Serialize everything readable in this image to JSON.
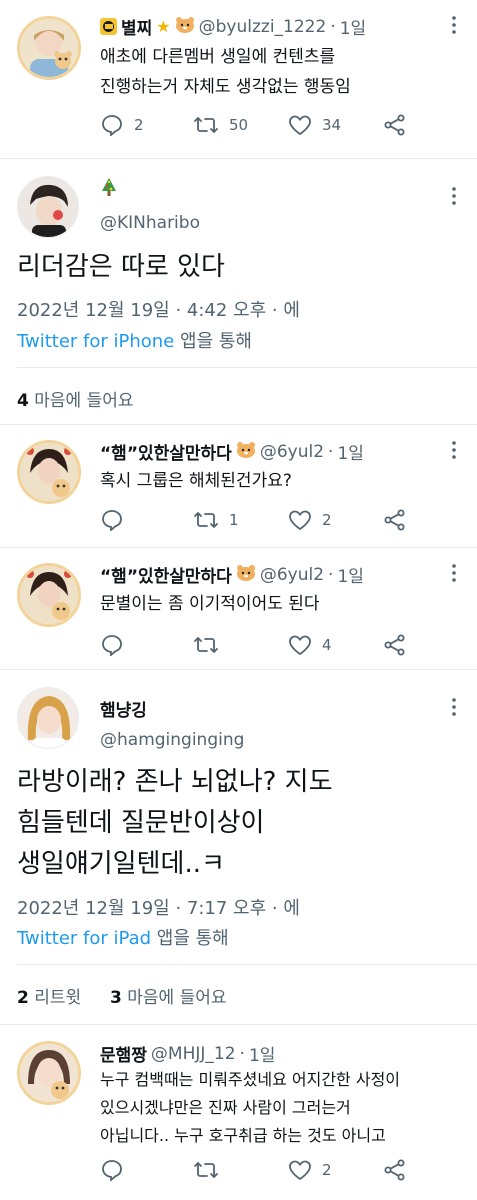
{
  "tweets": [
    {
      "name": "별찌",
      "name_emojis": "🌟🐹",
      "handle": "@byulzzi_1222",
      "time": "1일",
      "text_lines": [
        "애초에 다른멤버 생일에 컨텐츠를",
        "진행하는거 자체도 생각없는 행동임"
      ],
      "replies": "2",
      "retweets": "50",
      "likes": "34"
    },
    {
      "name_emoji": "🎄",
      "handle": "@KINharibo",
      "text": "리더감은 따로 있다",
      "date": "2022년 12월 19일 · 4:42 오후 · 에",
      "source_link": "Twitter for iPhone",
      "source_suffix": " 앱을 통해",
      "likes_count": "4",
      "likes_label": "마음에 들어요"
    },
    {
      "name": "“햄”있한살만하다",
      "name_emoji": "🐹",
      "handle": "@6yul2",
      "time": "1일",
      "text": "혹시 그룹은 해체된건가요?",
      "replies": "",
      "retweets": "1",
      "likes": "2"
    },
    {
      "name": "“햄”있한살만하다",
      "name_emoji": "🐹",
      "handle": "@6yul2",
      "time": "1일",
      "text": "문별이는 좀 이기적이어도 된다",
      "replies": "",
      "retweets": "",
      "likes": "4"
    },
    {
      "name": "햄냥깅",
      "handle": "@hamginginging",
      "text_lines": [
        "라방이래? 존나 뇌없나? 지도",
        "힘들텐데 질문반이상이",
        "생일얘기일텐데..ㅋ"
      ],
      "date": "2022년 12월 19일 · 7:17 오후 · 에",
      "source_link": "Twitter for iPad",
      "source_suffix": " 앱을 통해",
      "retweets_count": "2",
      "retweets_label": "리트윗",
      "likes_count": "3",
      "likes_label": "마음에 들어요"
    },
    {
      "name": "문햄짱",
      "handle": "@MHJJ_12",
      "time": "1일",
      "text_lines": [
        "누구 컴백때는 미뤄주셨네요 어지간한 사정이",
        "있으시겠냐만은 진짜 사람이 그러는거",
        "아닙니다.. 누구 호구취급 하는 것도 아니고"
      ],
      "replies": "",
      "retweets": "",
      "likes": "2"
    }
  ],
  "colors": {
    "accent": "#1d9bf0",
    "secondary_text": "#536471",
    "primary_text": "#0f1419",
    "divider": "#e6ecf0"
  },
  "icons": {
    "reply": "reply-icon",
    "retweet": "retweet-icon",
    "like": "like-icon",
    "share": "share-icon",
    "more": "more-icon"
  }
}
